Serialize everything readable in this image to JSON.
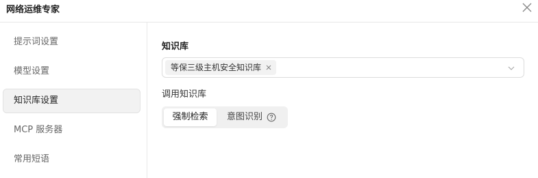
{
  "dialog": {
    "title": "网络运维专家"
  },
  "sidebar": {
    "items": [
      {
        "label": "提示词设置",
        "active": false
      },
      {
        "label": "模型设置",
        "active": false
      },
      {
        "label": "知识库设置",
        "active": true
      },
      {
        "label": "MCP 服务器",
        "active": false
      },
      {
        "label": "常用短语",
        "active": false
      }
    ]
  },
  "knowledge": {
    "section_label": "知识库",
    "selected_tags": [
      "等保三级主机安全知识库"
    ],
    "invoke_label": "调用知识库",
    "modes": [
      {
        "label": "强制检索",
        "selected": true
      },
      {
        "label": "意图识别",
        "selected": false
      }
    ]
  },
  "icons": {
    "close": "close-icon",
    "tag_remove": "tag-remove-icon",
    "dropdown": "chevron-down-icon",
    "help": "help-circle-icon"
  },
  "colors": {
    "active_bg": "#f2f2f2",
    "border": "#e8e8e8",
    "segment_bg": "#f0f0f0"
  }
}
